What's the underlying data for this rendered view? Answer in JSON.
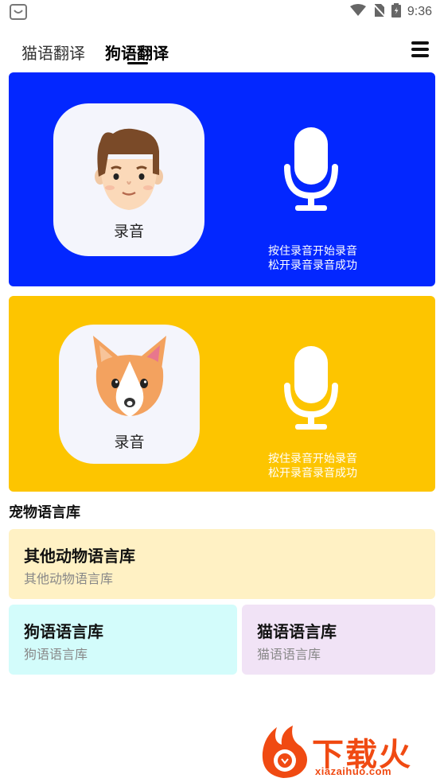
{
  "status_bar": {
    "time": "9:36"
  },
  "tabs": [
    {
      "label": "猫语翻译",
      "active": false
    },
    {
      "label": "狗语翻译",
      "active": true
    }
  ],
  "translator": {
    "human": {
      "record_label": "录音",
      "hint_line1": "按住录音开始录音",
      "hint_line2": "松开录音录音成功",
      "panel_color": "#0327ff"
    },
    "dog": {
      "record_label": "录音",
      "hint_line1": "按住录音开始录音",
      "hint_line2": "松开录音录音成功",
      "panel_color": "#fdc500"
    }
  },
  "library": {
    "section_title": "宠物语言库",
    "cards": [
      {
        "title": "其他动物语言库",
        "subtitle": "其他动物语言库",
        "color": "#fff1c4"
      },
      {
        "title": "狗语语言库",
        "subtitle": "狗语语言库",
        "color": "#d3fcfb"
      },
      {
        "title": "猫语语言库",
        "subtitle": "猫语语言库",
        "color": "#f1e3f6"
      }
    ]
  },
  "watermark": {
    "text": "下载火",
    "url": "xiazaihuo.com"
  },
  "icons": [
    "app-notification-icon",
    "wifi-icon",
    "no-sim-icon",
    "battery-icon",
    "menu-icon",
    "man-avatar-icon",
    "dog-avatar-icon",
    "microphone-icon"
  ]
}
